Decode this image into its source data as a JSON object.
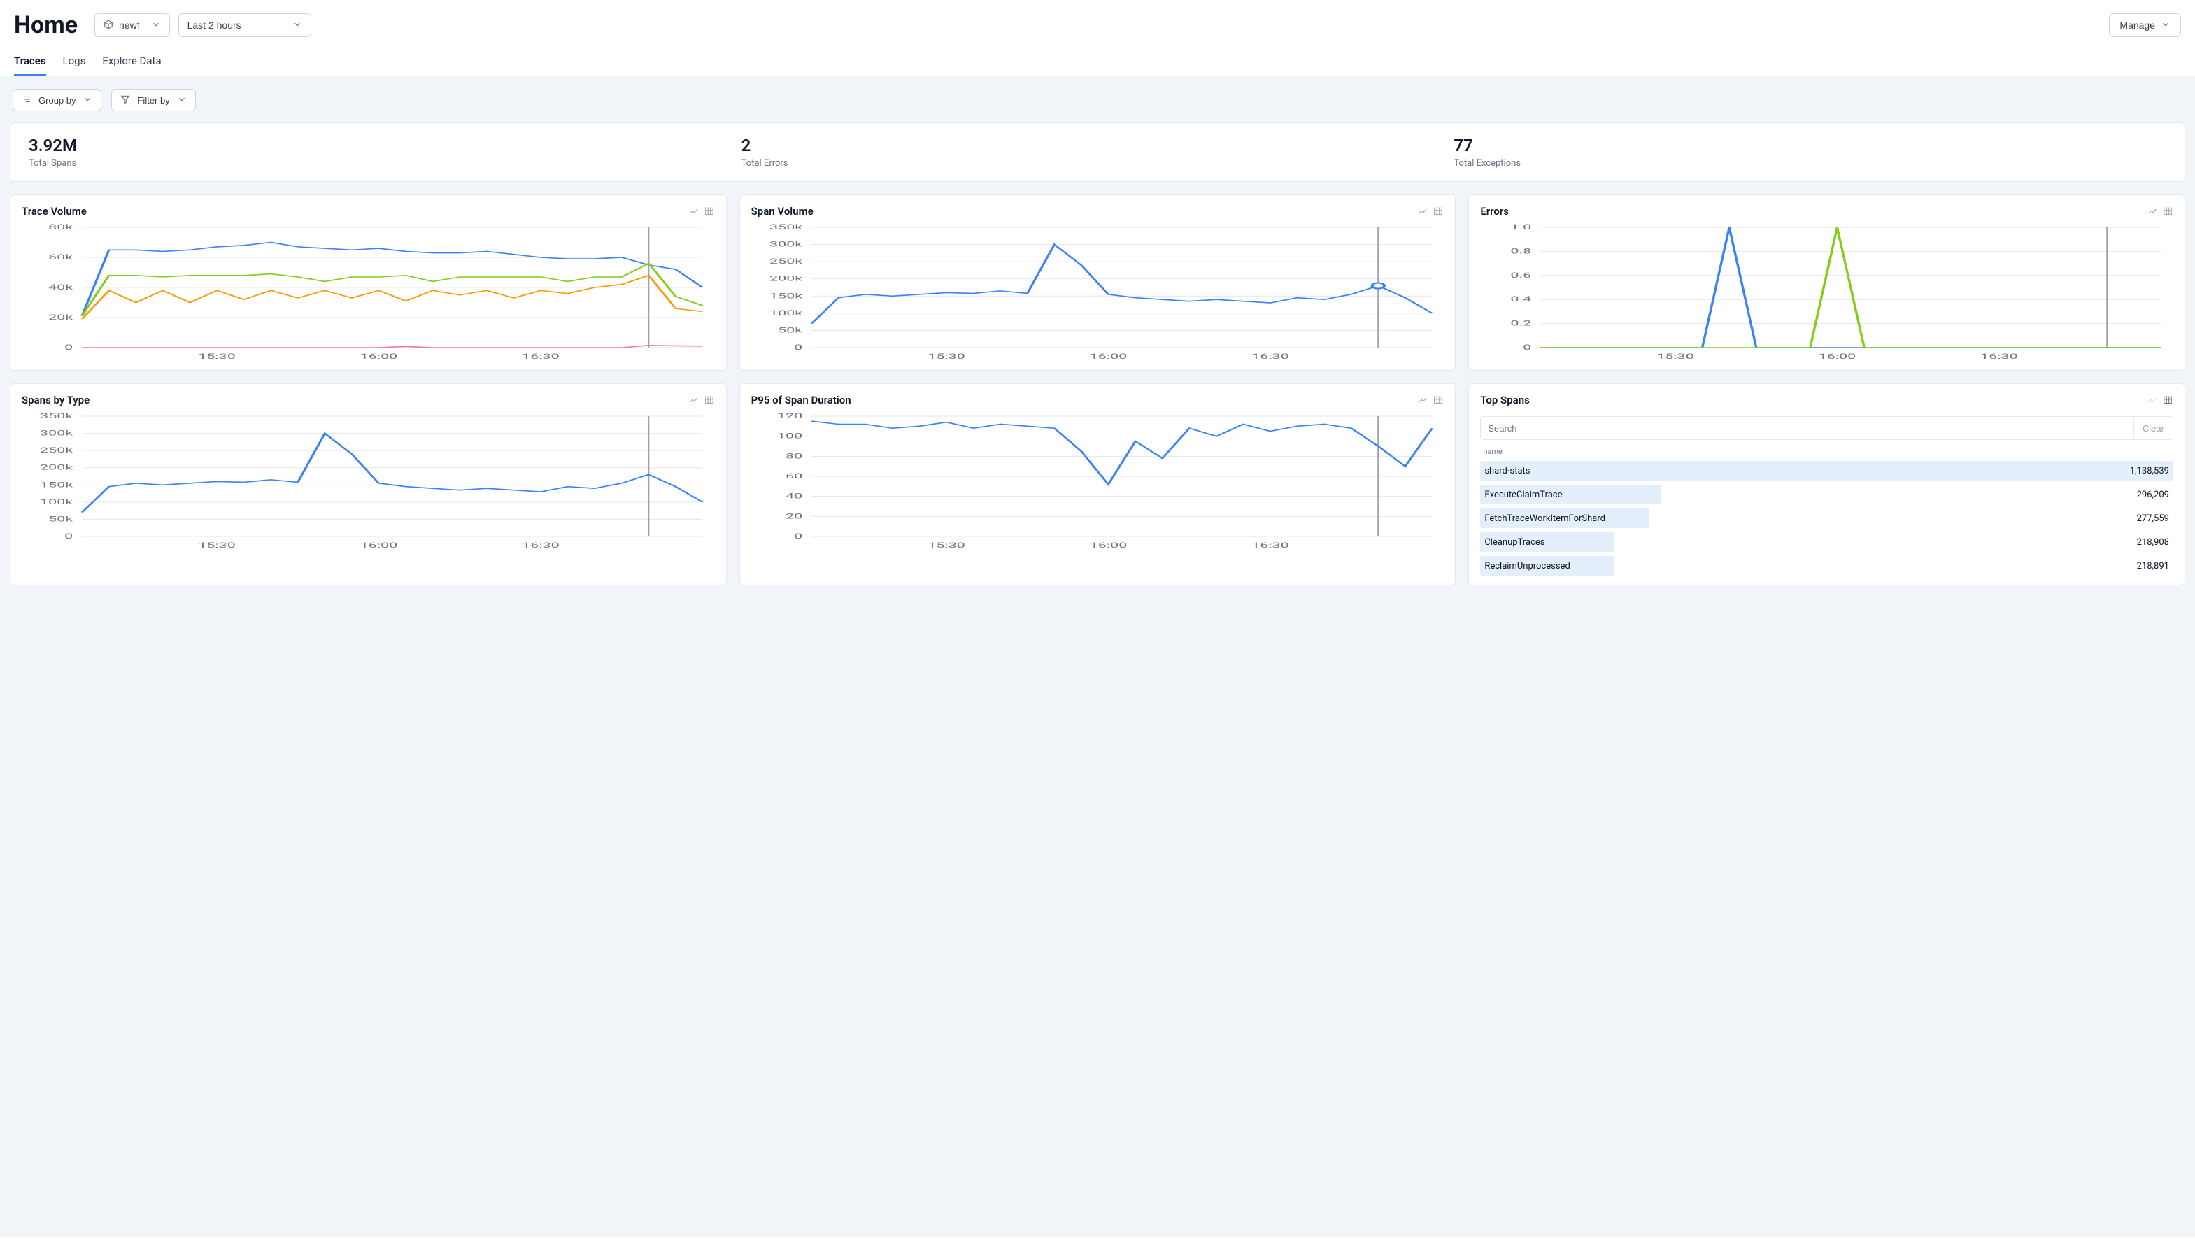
{
  "page_title": "Home",
  "project_selector": {
    "label": "newf"
  },
  "time_range_selector": {
    "label": "Last 2 hours"
  },
  "manage_button": "Manage",
  "tabs": [
    {
      "id": "traces",
      "label": "Traces",
      "active": true
    },
    {
      "id": "logs",
      "label": "Logs",
      "active": false
    },
    {
      "id": "explore",
      "label": "Explore Data",
      "active": false
    }
  ],
  "filters": {
    "group_by_label": "Group by",
    "filter_by_label": "Filter by"
  },
  "summary_stats": [
    {
      "value": "3.92M",
      "label": "Total Spans"
    },
    {
      "value": "2",
      "label": "Total Errors"
    },
    {
      "value": "77",
      "label": "Total Exceptions"
    }
  ],
  "x_axis_ticks": [
    "15:30",
    "16:00",
    "16:30"
  ],
  "charts": {
    "trace_volume": {
      "title": "Trace Volume",
      "y_ticks": [
        0,
        20000,
        40000,
        60000,
        80000
      ],
      "y_tick_labels": [
        "0",
        "20k",
        "40k",
        "60k",
        "80k"
      ]
    },
    "span_volume": {
      "title": "Span Volume",
      "y_ticks": [
        0,
        50000,
        100000,
        150000,
        200000,
        250000,
        300000,
        350000
      ],
      "y_tick_labels": [
        "0",
        "50k",
        "100k",
        "150k",
        "200k",
        "250k",
        "300k",
        "350k"
      ]
    },
    "errors": {
      "title": "Errors",
      "y_ticks": [
        0,
        0.2,
        0.4,
        0.6,
        0.8,
        1.0
      ],
      "y_tick_labels": [
        "0",
        "0.2",
        "0.4",
        "0.6",
        "0.8",
        "1.0"
      ]
    },
    "spans_by_type": {
      "title": "Spans by Type",
      "y_ticks": [
        0,
        50000,
        100000,
        150000,
        200000,
        250000,
        300000,
        350000
      ],
      "y_tick_labels": [
        "0",
        "50k",
        "100k",
        "150k",
        "200k",
        "250k",
        "300k",
        "350k"
      ]
    },
    "p95_span_duration": {
      "title": "P95 of Span Duration",
      "y_ticks": [
        0,
        20,
        40,
        60,
        80,
        100,
        120
      ],
      "y_tick_labels": [
        "0",
        "20",
        "40",
        "60",
        "80",
        "100",
        "120"
      ]
    }
  },
  "top_spans": {
    "title": "Top Spans",
    "search_placeholder": "Search",
    "clear_label": "Clear",
    "column_header": "name",
    "rows": [
      {
        "name": "shard-stats",
        "count": "1,138,539",
        "count_n": 1138539
      },
      {
        "name": "ExecuteClaimTrace",
        "count": "296,209",
        "count_n": 296209
      },
      {
        "name": "FetchTraceWorkItemForShard",
        "count": "277,559",
        "count_n": 277559
      },
      {
        "name": "CleanupTraces",
        "count": "218,908",
        "count_n": 218908
      },
      {
        "name": "ReclaimUnprocessed",
        "count": "218,891",
        "count_n": 218891
      }
    ]
  },
  "chart_data": [
    {
      "id": "trace_volume",
      "type": "line",
      "title": "Trace Volume",
      "xlabel": "",
      "ylabel": "",
      "ylim": [
        0,
        80000
      ],
      "x": [
        0,
        1,
        2,
        3,
        4,
        5,
        6,
        7,
        8,
        9,
        10,
        11,
        12,
        13,
        14,
        15,
        16,
        17,
        18,
        19,
        20,
        21,
        22,
        23
      ],
      "x_tick_labels": [
        "15:30",
        "16:00",
        "16:30"
      ],
      "series": [
        {
          "name": "blue",
          "color": "#3b82f6",
          "values": [
            21000,
            65000,
            65000,
            64000,
            65000,
            67000,
            68000,
            70000,
            67000,
            66000,
            65000,
            66000,
            64000,
            63000,
            63000,
            64000,
            62000,
            60000,
            59000,
            59000,
            60000,
            55000,
            52000,
            40000
          ]
        },
        {
          "name": "green",
          "color": "#84cc16",
          "values": [
            21000,
            48000,
            48000,
            47000,
            48000,
            48000,
            48000,
            49000,
            47000,
            44000,
            47000,
            47000,
            48000,
            44000,
            47000,
            47000,
            47000,
            47000,
            44000,
            47000,
            47000,
            56000,
            34000,
            28000
          ]
        },
        {
          "name": "orange",
          "color": "#f59e0b",
          "values": [
            19000,
            38000,
            30000,
            38000,
            30000,
            38000,
            32000,
            38000,
            33000,
            38000,
            33000,
            38000,
            31000,
            38000,
            35000,
            38000,
            33000,
            38000,
            36000,
            40000,
            42000,
            48000,
            26000,
            24000
          ]
        },
        {
          "name": "pink",
          "color": "#f472b6",
          "values": [
            0,
            0,
            0,
            0,
            0,
            0,
            0,
            0,
            0,
            0,
            0,
            0,
            800,
            0,
            0,
            0,
            0,
            0,
            0,
            0,
            0,
            1500,
            1200,
            1000
          ]
        }
      ]
    },
    {
      "id": "span_volume",
      "type": "line",
      "title": "Span Volume",
      "xlabel": "",
      "ylabel": "",
      "ylim": [
        0,
        350000
      ],
      "x": [
        0,
        1,
        2,
        3,
        4,
        5,
        6,
        7,
        8,
        9,
        10,
        11,
        12,
        13,
        14,
        15,
        16,
        17,
        18,
        19,
        20,
        21,
        22,
        23
      ],
      "x_tick_labels": [
        "15:30",
        "16:00",
        "16:30"
      ],
      "series": [
        {
          "name": "blue",
          "color": "#3b82f6",
          "values": [
            70000,
            145000,
            155000,
            150000,
            155000,
            160000,
            158000,
            165000,
            158000,
            300000,
            240000,
            155000,
            145000,
            140000,
            135000,
            140000,
            135000,
            130000,
            145000,
            140000,
            155000,
            180000,
            145000,
            100000
          ]
        }
      ],
      "marker": {
        "x": 21,
        "y": 180000
      }
    },
    {
      "id": "errors",
      "type": "line",
      "title": "Errors",
      "xlabel": "",
      "ylabel": "",
      "ylim": [
        0,
        1.0
      ],
      "x": [
        0,
        1,
        2,
        3,
        4,
        5,
        6,
        7,
        8,
        9,
        10,
        11,
        12,
        13,
        14,
        15,
        16,
        17,
        18,
        19,
        20,
        21,
        22,
        23
      ],
      "x_tick_labels": [
        "15:30",
        "16:00",
        "16:30"
      ],
      "series": [
        {
          "name": "blue",
          "color": "#3b82f6",
          "values": [
            0,
            0,
            0,
            0,
            0,
            0,
            0,
            1.0,
            0,
            0,
            0,
            0,
            0,
            0,
            0,
            0,
            0,
            0,
            0,
            0,
            0,
            0,
            0,
            0
          ]
        },
        {
          "name": "green",
          "color": "#84cc16",
          "values": [
            0,
            0,
            0,
            0,
            0,
            0,
            0,
            0,
            0,
            0,
            0,
            1.0,
            0,
            0,
            0,
            0,
            0,
            0,
            0,
            0,
            0,
            0,
            0,
            0
          ]
        }
      ]
    },
    {
      "id": "spans_by_type",
      "type": "line",
      "title": "Spans by Type",
      "xlabel": "",
      "ylabel": "",
      "ylim": [
        0,
        350000
      ],
      "x": [
        0,
        1,
        2,
        3,
        4,
        5,
        6,
        7,
        8,
        9,
        10,
        11,
        12,
        13,
        14,
        15,
        16,
        17,
        18,
        19,
        20,
        21,
        22,
        23
      ],
      "x_tick_labels": [
        "15:30",
        "16:00",
        "16:30"
      ],
      "series": [
        {
          "name": "blue",
          "color": "#3b82f6",
          "values": [
            70000,
            145000,
            155000,
            150000,
            155000,
            160000,
            158000,
            165000,
            158000,
            300000,
            240000,
            155000,
            145000,
            140000,
            135000,
            140000,
            135000,
            130000,
            145000,
            140000,
            155000,
            180000,
            145000,
            100000
          ]
        }
      ]
    },
    {
      "id": "p95_span_duration",
      "type": "line",
      "title": "P95 of Span Duration",
      "xlabel": "",
      "ylabel": "",
      "ylim": [
        0,
        120
      ],
      "x": [
        0,
        1,
        2,
        3,
        4,
        5,
        6,
        7,
        8,
        9,
        10,
        11,
        12,
        13,
        14,
        15,
        16,
        17,
        18,
        19,
        20,
        21,
        22,
        23
      ],
      "x_tick_labels": [
        "15:30",
        "16:00",
        "16:30"
      ],
      "series": [
        {
          "name": "blue",
          "color": "#3b82f6",
          "values": [
            115,
            112,
            112,
            108,
            110,
            114,
            108,
            112,
            110,
            108,
            85,
            52,
            95,
            78,
            108,
            100,
            112,
            105,
            110,
            112,
            108,
            90,
            70,
            108
          ]
        }
      ]
    }
  ]
}
